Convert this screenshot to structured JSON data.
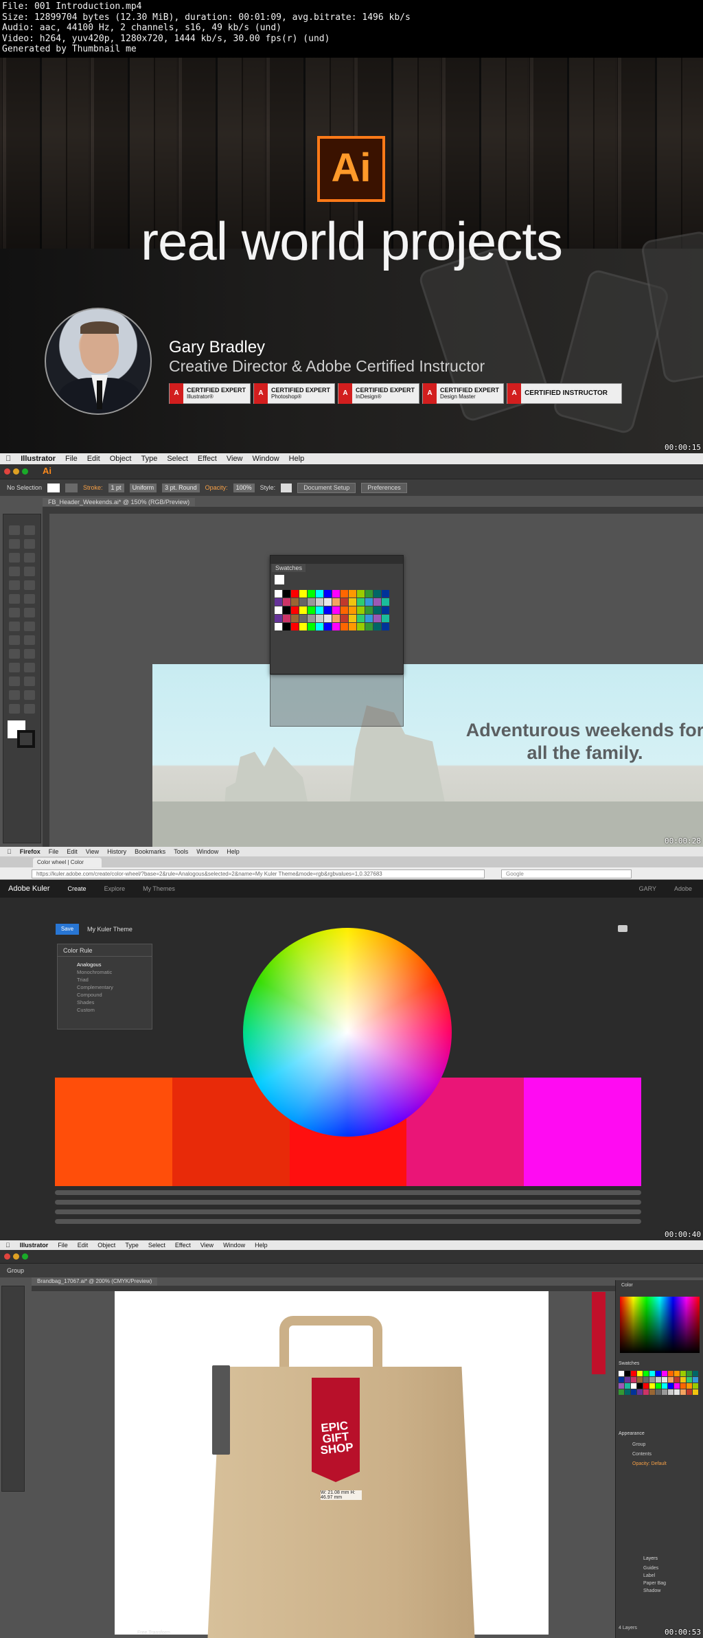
{
  "meta": {
    "line1": "File: 001 Introduction.mp4",
    "line2": "Size: 12899704 bytes (12.30 MiB), duration: 00:01:09, avg.bitrate: 1496 kb/s",
    "line3": "Audio: aac, 44100 Hz, 2 channels, s16, 49 kb/s (und)",
    "line4": "Video: h264, yuv420p, 1280x720, 1444 kb/s, 30.00 fps(r) (und)",
    "line5": "Generated by Thumbnail me"
  },
  "intro": {
    "logo": "Ai",
    "title": "real world projects",
    "name": "Gary Bradley",
    "role": "Creative Director & Adobe Certified Instructor",
    "badges": [
      {
        "t": "CERTIFIED EXPERT",
        "s": "Illustrator®"
      },
      {
        "t": "CERTIFIED EXPERT",
        "s": "Photoshop®"
      },
      {
        "t": "CERTIFIED EXPERT",
        "s": "InDesign®"
      },
      {
        "t": "CERTIFIED EXPERT",
        "s": "Design Master"
      },
      {
        "t": "CERTIFIED INSTRUCTOR",
        "s": ""
      }
    ],
    "timestamp": "00:00:15"
  },
  "ai1": {
    "menu": {
      "app": "Illustrator",
      "file": "File",
      "edit": "Edit",
      "object": "Object",
      "type": "Type",
      "select": "Select",
      "effect": "Effect",
      "view": "View",
      "window": "Window",
      "help": "Help"
    },
    "ctrl": {
      "selection": "No Selection",
      "stroke": "Stroke:",
      "stroke_val": "1 pt",
      "uniform": "Uniform",
      "round": "3 pt. Round",
      "opacity": "Opacity:",
      "opacity_val": "100%",
      "style": "Style:",
      "doc_setup": "Document Setup",
      "prefs": "Preferences"
    },
    "doc_tab": "FB_Header_Weekends.ai* @ 150% (RGB/Preview)",
    "panel_title": "Swatches",
    "headline": "Adventurous weekends for all the family.",
    "timestamp": "00:00:28"
  },
  "kuler": {
    "ffmenu": {
      "app": "Firefox",
      "file": "File",
      "edit": "Edit",
      "view": "View",
      "history": "History",
      "bookmarks": "Bookmarks",
      "tools": "Tools",
      "window": "Window",
      "help": "Help"
    },
    "tab": "Color wheel | Color schem...",
    "url": "https://kuler.adobe.com/create/color-wheel/?base=2&rule=Analogous&selected=2&name=My Kuler Theme&mode=rgb&rgbvalues=1,0.327683",
    "search": "Google",
    "nav": {
      "logo": "Adobe Kuler",
      "create": "Create",
      "explore": "Explore",
      "mythemes": "My Themes",
      "user": "GARY",
      "adobe": "Adobe"
    },
    "save": "Save",
    "theme": "My Kuler Theme",
    "rule_title": "Color Rule",
    "rules": [
      "Analogous",
      "Monochromatic",
      "Triad",
      "Complementary",
      "Compound",
      "Shades",
      "Custom"
    ],
    "palette": [
      "#ff4e0a",
      "#e82a09",
      "#ff0f0f",
      "#ea1577",
      "#ff0bf2"
    ],
    "timestamp": "00:00:40"
  },
  "ai2": {
    "menu": {
      "app": "Illustrator",
      "file": "File",
      "edit": "Edit",
      "object": "Object",
      "type": "Type",
      "select": "Select",
      "effect": "Effect",
      "view": "View",
      "window": "Window",
      "help": "Help"
    },
    "selection": "Group",
    "doc_tab": "Brandbag_17067.ai* @ 200% (CMYK/Preview)",
    "tag_text": "EPIC GIFT SHOP",
    "dims": "W: 21.08 mm H: 46.97 mm",
    "panels": {
      "color": "Color",
      "swatches": "Swatches",
      "appearance": "Appearance",
      "group": "Group",
      "contents": "Contents",
      "opacity": "Opacity: Default",
      "layers": "Layers"
    },
    "layers": [
      "Guides",
      "Label",
      "Paper Bag",
      "Shadow"
    ],
    "status": "Free Transform",
    "layer_count": "4 Layers",
    "timestamp": "00:00:53"
  }
}
